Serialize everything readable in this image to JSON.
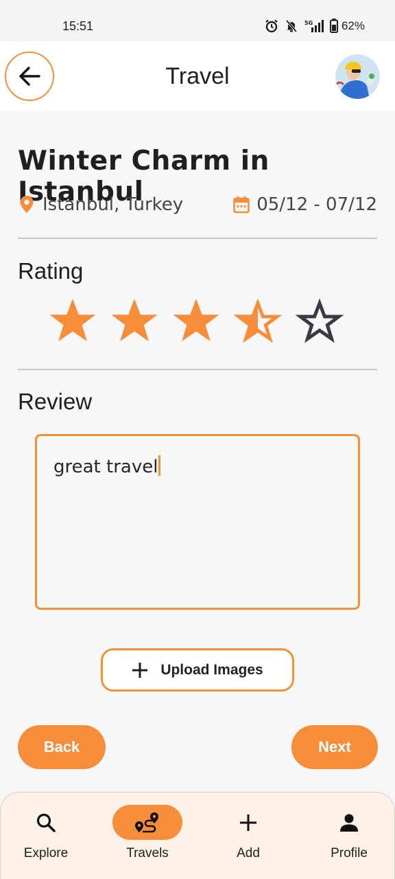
{
  "status_bar": {
    "time": "15:51",
    "battery": "62%"
  },
  "app_bar": {
    "title": "Travel"
  },
  "trip": {
    "title": "Winter Charm in Istanbul",
    "location": "Istanbul, Turkey",
    "dates": "05/12 - 07/12"
  },
  "rating": {
    "label": "Rating",
    "value": 3.5,
    "max": 5
  },
  "review": {
    "label": "Review",
    "text": "great travel"
  },
  "upload": {
    "label": "Upload Images"
  },
  "actions": {
    "back": "Back",
    "next": "Next"
  },
  "nav": {
    "items": [
      {
        "label": "Explore",
        "icon": "search-icon"
      },
      {
        "label": "Travels",
        "icon": "route-icon",
        "active": true
      },
      {
        "label": "Add",
        "icon": "plus-icon"
      },
      {
        "label": "Profile",
        "icon": "person-icon"
      }
    ]
  },
  "colors": {
    "accent": "#F68D3B",
    "nav_background": "#FDF1E8",
    "empty_star": "#3A3A44"
  }
}
